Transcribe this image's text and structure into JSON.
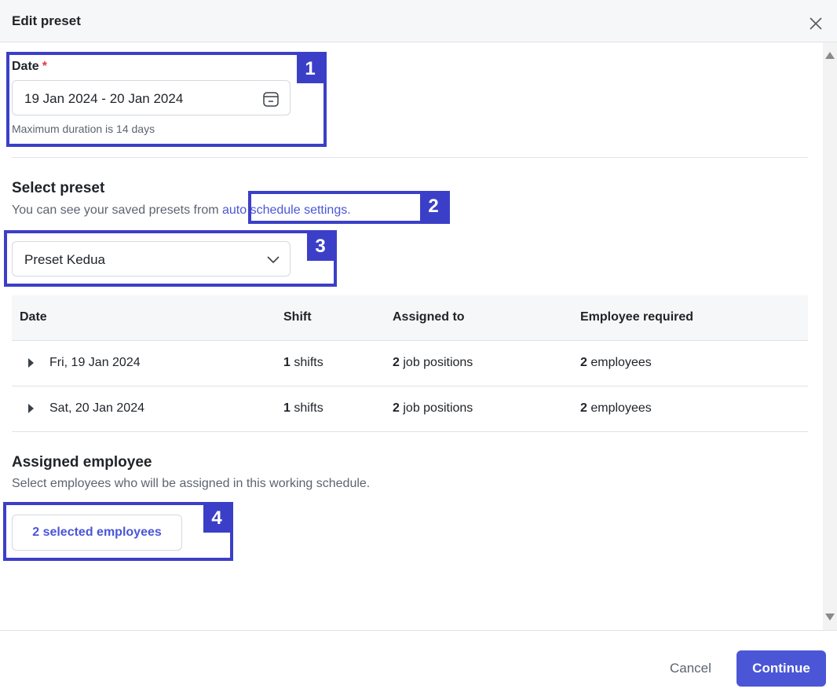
{
  "header": {
    "title": "Edit preset"
  },
  "date_field": {
    "label": "Date",
    "required_mark": "*",
    "value": "19 Jan 2024 - 20 Jan 2024",
    "hint": "Maximum duration is 14 days"
  },
  "preset_section": {
    "title": "Select preset",
    "subtitle_prefix": "You can see your saved presets from ",
    "subtitle_link": "auto schedule settings.",
    "selected": "Preset Kedua"
  },
  "table": {
    "headers": [
      "Date",
      "Shift",
      "Assigned to",
      "Employee required"
    ],
    "rows": [
      {
        "date": "Fri, 19 Jan 2024",
        "shift_count": "1",
        "shift_unit": "shifts",
        "assigned_count": "2",
        "assigned_unit": "job positions",
        "required_count": "2",
        "required_unit": "employees"
      },
      {
        "date": "Sat, 20 Jan 2024",
        "shift_count": "1",
        "shift_unit": "shifts",
        "assigned_count": "2",
        "assigned_unit": "job positions",
        "required_count": "2",
        "required_unit": "employees"
      }
    ]
  },
  "employee_section": {
    "title": "Assigned employee",
    "subtitle": "Select employees who will be assigned in this working schedule.",
    "button_label": "2 selected employees"
  },
  "footer": {
    "cancel_label": "Cancel",
    "continue_label": "Continue"
  },
  "annotations": [
    "1",
    "2",
    "3",
    "4"
  ],
  "colors": {
    "accent": "#4a56d6",
    "annotation": "#3b3fc8",
    "required": "#e5393b"
  }
}
